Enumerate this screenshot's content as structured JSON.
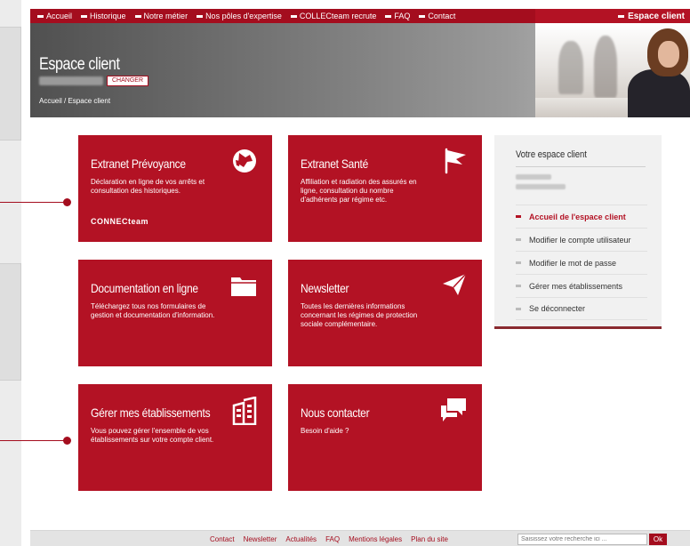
{
  "nav": {
    "items": [
      "Accueil",
      "Historique",
      "Notre métier",
      "Nos pôles d'expertise",
      "COLLECteam recrute",
      "FAQ",
      "Contact"
    ],
    "right": "Espace client"
  },
  "banner": {
    "title": "Espace client",
    "change_label": "CHANGER",
    "breadcrumb": "Accueil / Espace client"
  },
  "tiles": [
    {
      "title": "Extranet Prévoyance",
      "desc": "Déclaration en ligne de vos arrêts et consultation des historiques.",
      "brand": "CONNECteam",
      "icon": "globe-icon"
    },
    {
      "title": "Extranet Santé",
      "desc": "Affiliation et radiation des assurés en ligne, consultation du nombre d'adhérents par régime etc.",
      "icon": "flag-icon"
    },
    {
      "title": "Documentation en ligne",
      "desc": "Téléchargez tous nos formulaires de gestion et documentation d'information.",
      "icon": "folder-icon"
    },
    {
      "title": "Newsletter",
      "desc": "Toutes les dernières informations concernant les régimes de protection sociale complémentaire.",
      "icon": "paper-plane-icon"
    },
    {
      "title": "Gérer mes établissements",
      "desc": "Vous pouvez gérer l'ensemble de vos établissements sur votre compte client.",
      "icon": "buildings-icon"
    },
    {
      "title": "Nous contacter",
      "desc": "Besoin d'aide ?",
      "icon": "chat-bubbles-icon"
    }
  ],
  "sidebar": {
    "title": "Votre espace client",
    "items": [
      "Accueil de l'espace client",
      "Modifier le compte utilisateur",
      "Modifier le mot de passe",
      "Gérer mes établissements",
      "Se déconnecter"
    ]
  },
  "footer": {
    "links": [
      "Contact",
      "Newsletter",
      "Actualités",
      "FAQ",
      "Mentions légales",
      "Plan du site"
    ],
    "search_placeholder": "Saisissez votre recherche ici ...",
    "ok_label": "Ok"
  },
  "colors": {
    "brand": "#b31224",
    "nav": "#a40d1e"
  }
}
